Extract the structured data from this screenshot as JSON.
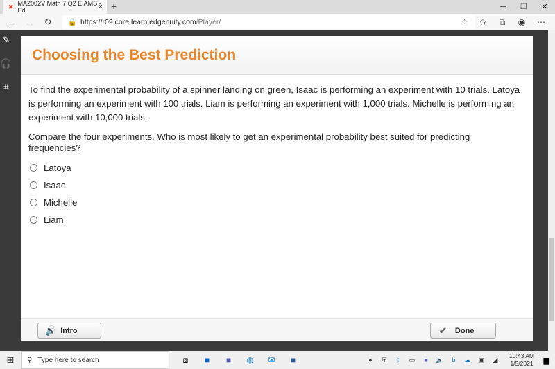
{
  "browser": {
    "tab_title": "MA2002V Math 7 Q2 EIAMS - Ed",
    "url_main": "https://r09.core.learn.edgenuity.com",
    "url_path": "/Player/"
  },
  "lesson": {
    "title": "Choosing the Best Prediction",
    "passage": "To find the experimental probability of a spinner landing on green, Isaac is performing an experiment with 10 trials. Latoya is performing an experiment with 100 trials. Liam is performing an experiment with 1,000 trials. Michelle is performing an experiment with 10,000 trials.",
    "question": "Compare the four experiments. Who is most likely to get an experimental probability best suited for predicting frequencies?",
    "options": [
      {
        "label": "Latoya"
      },
      {
        "label": "Isaac"
      },
      {
        "label": "Michelle"
      },
      {
        "label": "Liam"
      }
    ]
  },
  "footer": {
    "intro_label": "Intro",
    "done_label": "Done"
  },
  "taskbar": {
    "search_placeholder": "Type here to search",
    "time": "10:43 AM",
    "date": "1/5/2021"
  },
  "colors": {
    "title": "#e8862b"
  }
}
